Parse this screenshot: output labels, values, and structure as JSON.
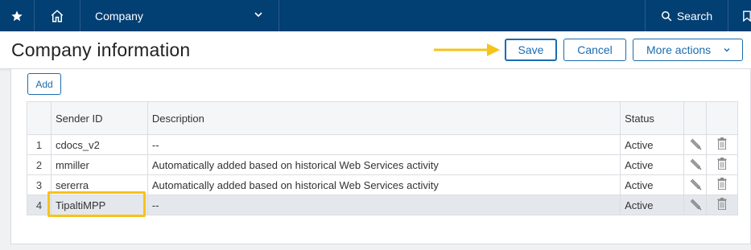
{
  "nav": {
    "company": "Company",
    "search": "Search"
  },
  "page": {
    "title": "Company information",
    "save": "Save",
    "cancel": "Cancel",
    "more_actions": "More actions",
    "add": "Add"
  },
  "table": {
    "headers": [
      "",
      "Sender ID",
      "Description",
      "Status",
      "",
      ""
    ],
    "rows": [
      {
        "num": "1",
        "sender_id": "cdocs_v2",
        "description": "--",
        "status": "Active"
      },
      {
        "num": "2",
        "sender_id": "mmiller",
        "description": "Automatically added based on historical Web Services activity",
        "status": "Active"
      },
      {
        "num": "3",
        "sender_id": "sererra",
        "description": "Automatically added based on historical Web Services activity",
        "status": "Active"
      },
      {
        "num": "4",
        "sender_id": "TipaltiMPP",
        "description": "--",
        "status": "Active"
      }
    ],
    "selected_row": 4
  },
  "colors": {
    "nav_bg": "#023f73",
    "accent": "#1b6bb0",
    "highlight": "#f7c31a"
  },
  "icons": [
    "star-icon",
    "home-icon",
    "chevron-down-icon",
    "search-icon",
    "bookmark-icon",
    "pencil-icon",
    "trash-icon",
    "arrow-right-icon"
  ]
}
